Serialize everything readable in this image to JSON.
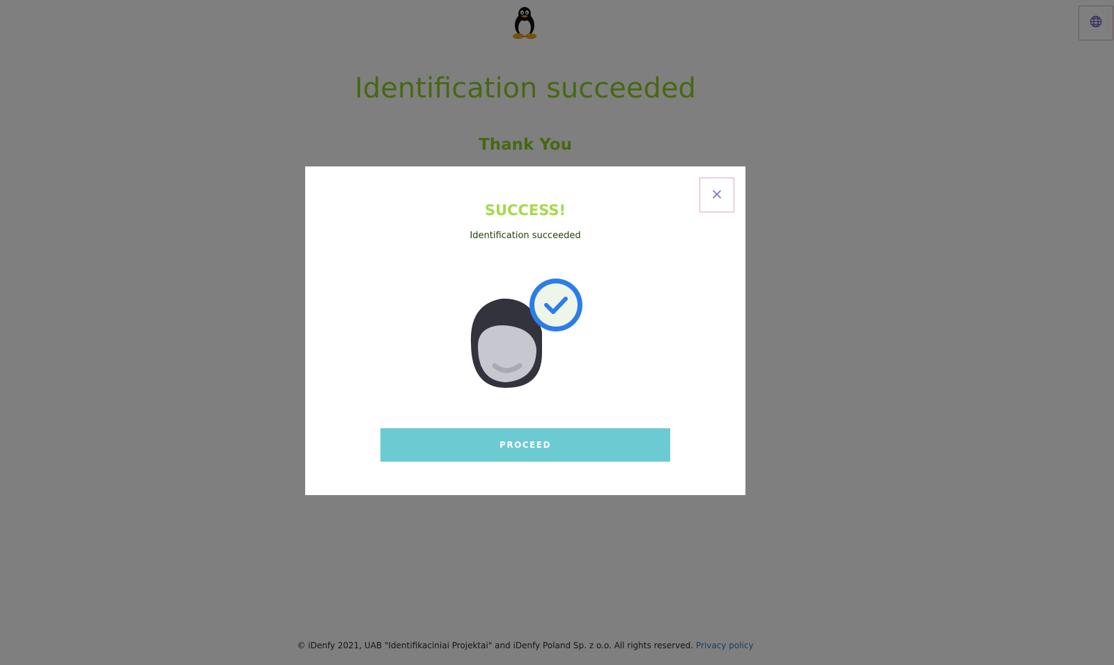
{
  "header": {
    "logo": "tux-penguin-icon",
    "language_icon": "globe-icon"
  },
  "page": {
    "title": "Identification succeeded",
    "subtitle": "Thank You"
  },
  "modal": {
    "close_icon": "close-icon",
    "title": "SUCCESS!",
    "message": "Identification succeeded",
    "illustration": "face-verified-icon",
    "proceed_label": "PROCEED"
  },
  "footer": {
    "copyright": "© iDenfy 2021, UAB \"Identifikaciniai Projektai\" and iDenfy Poland Sp. z o.o. All rights reserved.",
    "privacy_label": "Privacy policy"
  },
  "colors": {
    "title_green": "#8fd126",
    "success_green": "#a6d94c",
    "proceed_teal": "#6ccad3",
    "check_blue": "#2b7de9",
    "close_purple": "#7b6fd0"
  }
}
